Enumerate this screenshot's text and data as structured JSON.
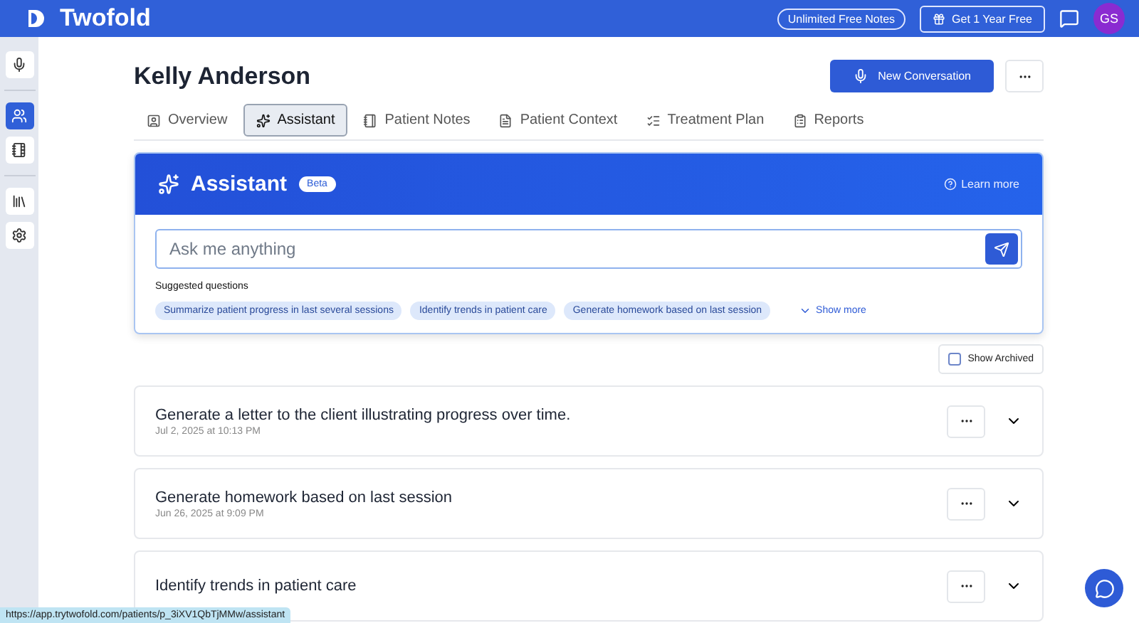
{
  "app": {
    "name": "Twofold"
  },
  "header": {
    "plan_badge": "Unlimited Free Notes",
    "promo_button": "Get 1 Year Free",
    "avatar": "GS"
  },
  "sidebar": {
    "items": [
      {
        "kind": "mic",
        "selected": false
      },
      {
        "kind": "divider"
      },
      {
        "kind": "users",
        "selected": true
      },
      {
        "kind": "notebook",
        "selected": false
      },
      {
        "kind": "divider"
      },
      {
        "kind": "library",
        "selected": false
      },
      {
        "kind": "settings",
        "selected": false
      }
    ]
  },
  "patient": {
    "name": "Kelly Anderson",
    "new_button": "New Conversation"
  },
  "tabs": [
    {
      "label": "Overview",
      "selected": false
    },
    {
      "label": "Assistant",
      "selected": true
    },
    {
      "label": "Patient Notes",
      "selected": false
    },
    {
      "label": "Patient Context",
      "selected": false
    },
    {
      "label": "Treatment Plan",
      "selected": false
    },
    {
      "label": "Reports",
      "selected": false
    }
  ],
  "assistant": {
    "title": "Assistant",
    "badge": "Beta",
    "learn_more": "Learn more",
    "placeholder": "Ask me anything",
    "suggested_label": "Suggested questions",
    "suggestions": [
      "Summarize patient progress in last several sessions",
      "Identify trends in patient care",
      "Generate homework based on last session"
    ],
    "show_more": "Show more"
  },
  "show_archived": {
    "label": "Show Archived",
    "checked": false
  },
  "conversations": [
    {
      "title": "Generate a letter to the client illustrating progress over time.",
      "date": "Jul 2, 2025 at 10:13 PM"
    },
    {
      "title": "Generate homework based on last session",
      "date": "Jun 26, 2025 at 9:09 PM"
    },
    {
      "title": "Identify trends in patient care"
    }
  ],
  "status_url": "https://app.trytwofold.com/patients/p_3iXV1QbTjMMw/assistant"
}
